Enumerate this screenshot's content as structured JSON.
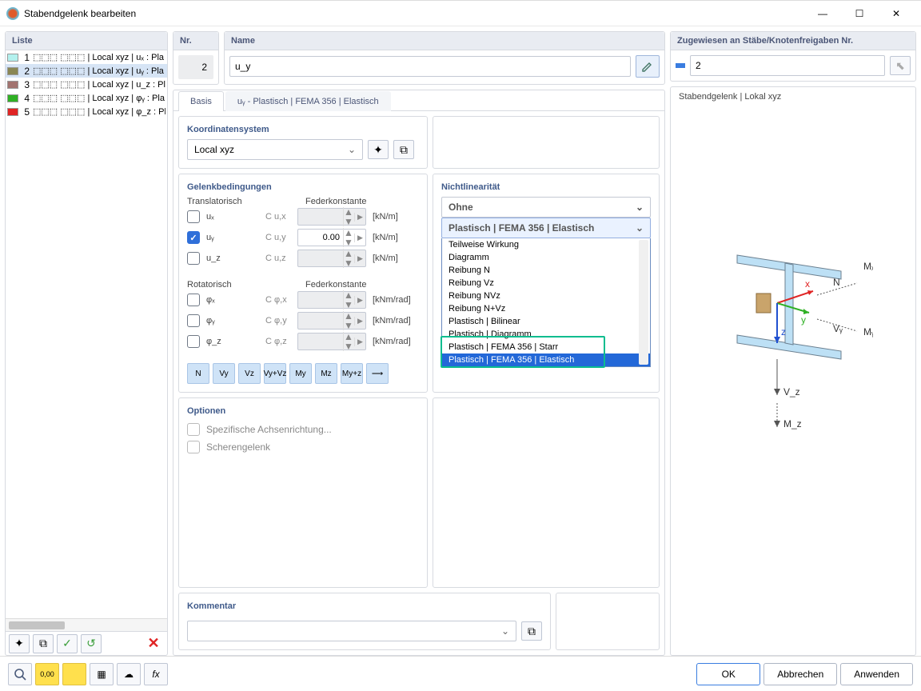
{
  "title": "Stabendgelenk bearbeiten",
  "list": {
    "header": "Liste",
    "items": [
      {
        "n": 1,
        "color": "#b3f1ee",
        "text": "⬚⬚⬚ ⬚⬚⬚ | Local xyz | uₓ : Pla"
      },
      {
        "n": 2,
        "color": "#8a8754",
        "text": "⬚⬚⬚ ⬚⬚⬚ | Local xyz | uᵧ : Pla",
        "sel": true
      },
      {
        "n": 3,
        "color": "#a2736f",
        "text": "⬚⬚⬚ ⬚⬚⬚ | Local xyz | u_z : Pla"
      },
      {
        "n": 4,
        "color": "#2fb024",
        "text": "⬚⬚⬚ ⬚⬚⬚ | Local xyz | φᵧ : Pla"
      },
      {
        "n": 5,
        "color": "#e02424",
        "text": "⬚⬚⬚ ⬚⬚⬚ | Local xyz | φ_z : Pla"
      }
    ]
  },
  "nr": {
    "label": "Nr.",
    "value": "2"
  },
  "name": {
    "label": "Name",
    "value": "u_y"
  },
  "assigned": {
    "label": "Zugewiesen an Stäbe/Knotenfreigaben Nr.",
    "value": "2"
  },
  "tabs": {
    "basis": "Basis",
    "second": "uᵧ - Plastisch | FEMA 356 | Elastisch"
  },
  "coord": {
    "header": "Koordinatensystem",
    "value": "Local xyz"
  },
  "hinge": {
    "header": "Gelenkbedingungen",
    "trans_h": "Translatorisch",
    "feder_h": "Federkonstante",
    "rot_h": "Rotatorisch",
    "rows_t": [
      {
        "lbl": "uₓ",
        "const": "C u,x",
        "val": "",
        "unit": "[kN/m]",
        "on": false
      },
      {
        "lbl": "uᵧ",
        "const": "C u,y",
        "val": "0.00",
        "unit": "[kN/m]",
        "on": true
      },
      {
        "lbl": "u_z",
        "const": "C u,z",
        "val": "",
        "unit": "[kN/m]",
        "on": false
      }
    ],
    "rows_r": [
      {
        "lbl": "φₓ",
        "const": "C φ,x",
        "val": "",
        "unit": "[kNm/rad]",
        "on": false
      },
      {
        "lbl": "φᵧ",
        "const": "C φ,y",
        "val": "",
        "unit": "[kNm/rad]",
        "on": false
      },
      {
        "lbl": "φ_z",
        "const": "C φ,z",
        "val": "",
        "unit": "[kNm/rad]",
        "on": false
      }
    ],
    "types": [
      "N",
      "Vy",
      "Vz",
      "Vy+Vz",
      "My",
      "Mz",
      "My+z",
      "⟶"
    ]
  },
  "nl": {
    "header": "Nichtlinearität",
    "closed_value": "Ohne",
    "open_value": "Plastisch | FEMA 356 | Elastisch",
    "options": [
      "Teilweise Wirkung",
      "Diagramm",
      "Reibung N",
      "Reibung Vz",
      "Reibung NVz",
      "Reibung N+Vz",
      "Plastisch | Bilinear",
      "Plastisch | Diagramm",
      "Plastisch | FEMA 356 | Starr",
      "Plastisch | FEMA 356 | Elastisch"
    ],
    "selected_index": 9
  },
  "options": {
    "header": "Optionen",
    "items": [
      "Spezifische Achsenrichtung...",
      "Scherengelenk"
    ]
  },
  "preview": {
    "label": "Stabendgelenk | Lokal xyz"
  },
  "kommentar": {
    "header": "Kommentar"
  },
  "footer": {
    "ok": "OK",
    "cancel": "Abbrechen",
    "apply": "Anwenden"
  }
}
